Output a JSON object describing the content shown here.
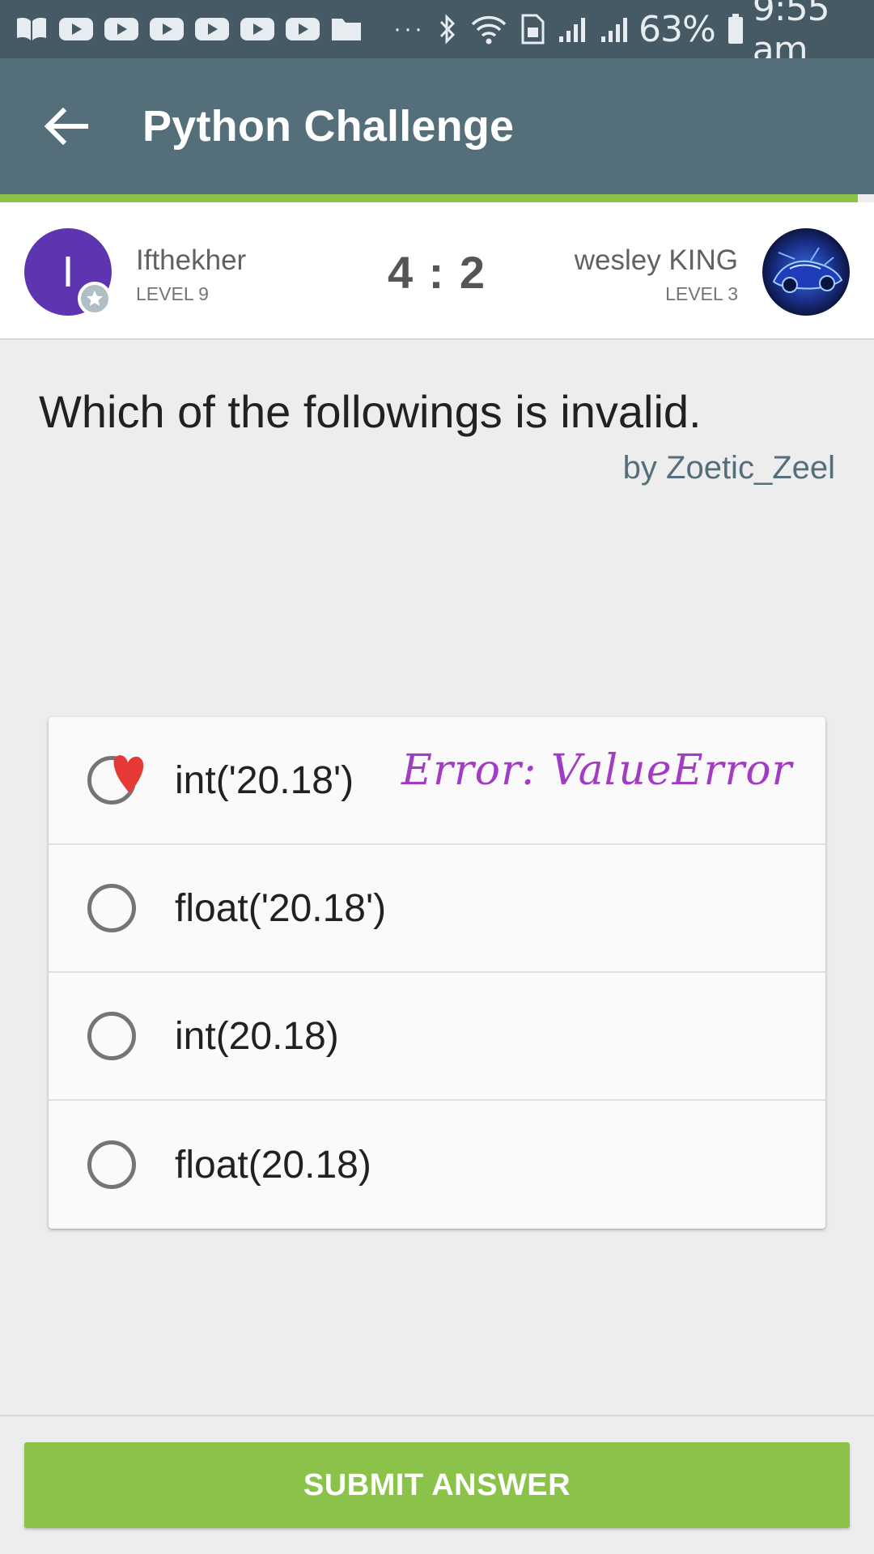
{
  "status_bar": {
    "left_icons": [
      "book-icon",
      "youtube-icon",
      "youtube-icon",
      "youtube-icon",
      "youtube-icon",
      "youtube-icon",
      "youtube-icon",
      "folder-icon"
    ],
    "overflow": "···",
    "battery_percent": "63%",
    "time": "9:55 am"
  },
  "app_bar": {
    "title": "Python Challenge"
  },
  "players": {
    "left": {
      "avatar_letter": "I",
      "name": "Ifthekher",
      "level": "LEVEL 9"
    },
    "score": "4 : 2",
    "right": {
      "name": "wesley KING",
      "level": "LEVEL 3"
    }
  },
  "question": {
    "text": "Which of the followings is invalid.",
    "author": "by Zoetic_Zeel"
  },
  "options": [
    {
      "label": "int('20.18')"
    },
    {
      "label": "float('20.18')"
    },
    {
      "label": "int(20.18)"
    },
    {
      "label": "float(20.18)"
    }
  ],
  "annotation": {
    "text": "Error: ValueError",
    "color": "#a23cc4"
  },
  "submit": {
    "label": "SUBMIT ANSWER"
  },
  "colors": {
    "status_bar": "#455a64",
    "app_bar": "#546e7a",
    "accent_green": "#8bc34a",
    "avatar_purple": "#5e35b1"
  }
}
